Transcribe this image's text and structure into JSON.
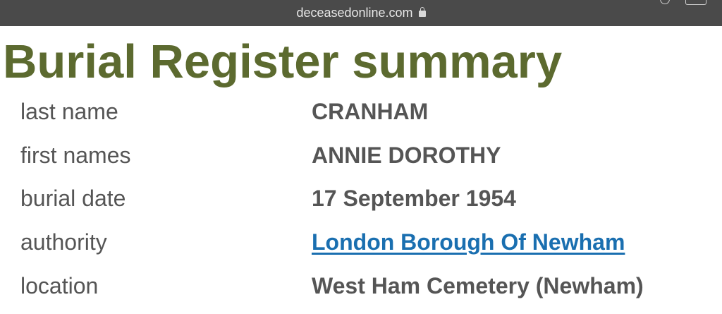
{
  "browser": {
    "url": "deceasedonline.com"
  },
  "page": {
    "title": "Burial Register summary"
  },
  "record": [
    {
      "label": "last name",
      "value": "CRANHAM",
      "is_link": false
    },
    {
      "label": "first names",
      "value": "ANNIE DOROTHY",
      "is_link": false
    },
    {
      "label": "burial date",
      "value": "17 September 1954",
      "is_link": false
    },
    {
      "label": "authority",
      "value": "London Borough Of Newham",
      "is_link": true
    },
    {
      "label": "location",
      "value": "West Ham Cemetery (Newham)",
      "is_link": false
    }
  ],
  "colors": {
    "title": "#5c6a2f",
    "text": "#555555",
    "link": "#1a6fb0",
    "urlbar": "#4a4a4a"
  },
  "icons": [
    "lock-icon",
    "reload-icon",
    "tabs-icon"
  ]
}
